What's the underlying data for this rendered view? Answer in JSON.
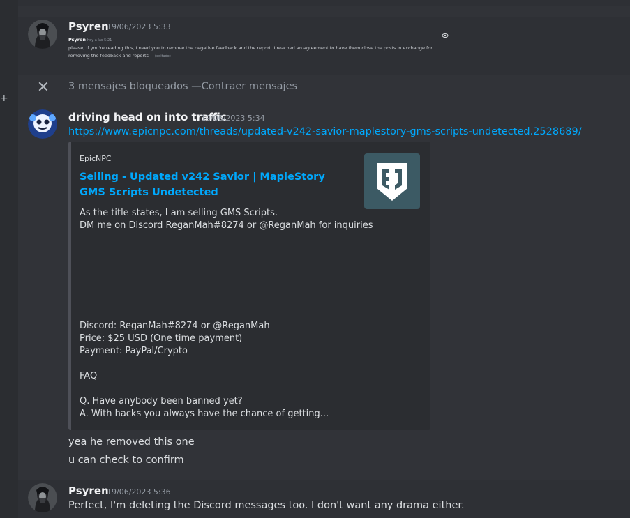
{
  "messages": {
    "first": {
      "author": "Psyren",
      "timestamp": "19/06/2023 5:33",
      "quoted": {
        "author": "Psyren",
        "timestamp": "hoy a las 5:21",
        "line1": "please, if you're reading this, I need you to remove the negative feedback and the report. I reached an agreement  to have them close the posts in exchange for",
        "line2": "removing the feedback and reports",
        "edited": "(editado)"
      }
    },
    "blocked": {
      "text": "3 mensajes bloqueados — ",
      "collapse_label": "Contraer mensajes"
    },
    "second": {
      "author": "driving head on into traffic",
      "timestamp": "19/06/2023 5:34",
      "link": "https://www.epicnpc.com/threads/updated-v242-savior-maplestory-gms-scripts-undetected.2528689/",
      "embed": {
        "provider": "EpicNPC",
        "title": "Selling - Updated v242 Savior | MapleStory GMS Scripts Undetected",
        "desc_lines": [
          "As the title states, I am selling GMS Scripts.",
          "DM me on Discord ReganMah#8274 or @ReganMah for inquiries",
          "",
          "",
          "",
          "",
          "",
          "",
          "",
          "Discord: ReganMah#8274 or @ReganMah",
          "Price: $25 USD (One time payment)",
          "Payment: PayPal/Crypto",
          "",
          "FAQ",
          "",
          "Q. Have anybody been banned yet?",
          "A. With hacks you always have the chance of getting..."
        ]
      },
      "followups": [
        "yea he removed this one",
        "u can check to confirm"
      ]
    },
    "third": {
      "author": "Psyren",
      "timestamp": "19/06/2023 5:36",
      "text": "Perfect, I'm deleting the Discord messages too. I don't want any drama either."
    }
  },
  "gutter": {
    "plus": "+"
  },
  "colors": {
    "background": "#313338",
    "link": "#00a8fc",
    "embed_thumb": "#3c5a64"
  },
  "icons": [
    "close-icon",
    "epicnpc-logo-icon",
    "avatar-psyren",
    "avatar-driving"
  ]
}
